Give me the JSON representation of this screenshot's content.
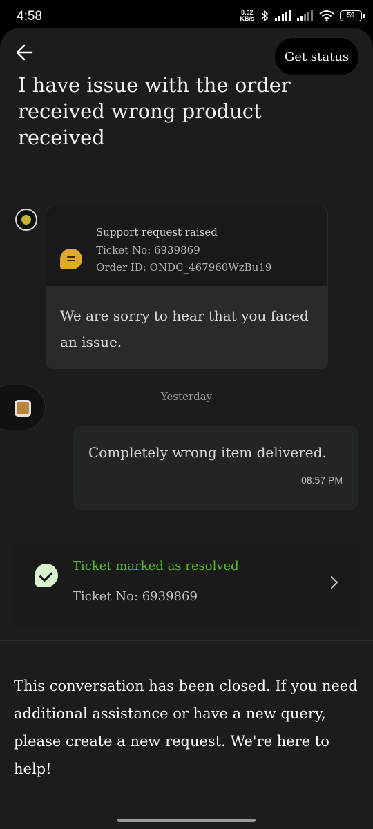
{
  "status_bar": {
    "time": "4:58",
    "net_speed_value": "0.02",
    "net_speed_unit": "KB/s",
    "battery": "59"
  },
  "header": {
    "get_status_label": "Get status",
    "title": "I have issue with the order received wrong product received"
  },
  "support_card": {
    "heading": "Support request raised",
    "ticket_line": "Ticket No: 6939869",
    "order_line": "Order ID: ONDC_467960WzBu19",
    "message": "We are sorry to hear that you faced an issue."
  },
  "date_separator": "Yesterday",
  "user_message": {
    "text": "Completely wrong item delivered.",
    "time": "08:57 PM"
  },
  "resolved_card": {
    "title": "Ticket marked as resolved",
    "ticket": "Ticket No: 6939869"
  },
  "closed_note": "This conversation has been closed. If you need additional assistance or have a new query, please create a new request. We're here to help!",
  "colors": {
    "background": "#1c1c1c",
    "resolved_green": "#58b82f",
    "bot_yellow": "#c2b334",
    "chat_icon_amber": "#e0a82e"
  },
  "icons": [
    "back-arrow-icon",
    "bluetooth-icon",
    "signal-icon",
    "wifi-icon",
    "battery-icon",
    "bot-indicator-icon",
    "chat-bubble-icon",
    "avatar-icon",
    "check-icon",
    "chevron-right-icon"
  ]
}
